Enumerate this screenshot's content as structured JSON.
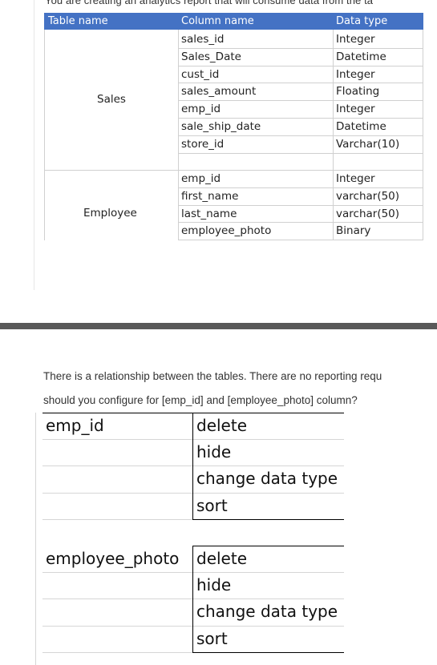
{
  "question_top": {
    "intro_text": "You are creating an analytics report that will consume data from the ta",
    "headers": [
      "Table name",
      "Column name",
      "Data type"
    ],
    "sales": {
      "table_name": "Sales",
      "columns": [
        "sales_id",
        "Sales_Date",
        "cust_id",
        "sales_amount",
        "emp_id",
        "sale_ship_date",
        "store_id"
      ],
      "types": [
        "Integer",
        "Datetime",
        "Integer",
        "Floating",
        "Integer",
        "Datetime",
        "Varchar(10)"
      ]
    },
    "employee": {
      "table_name": "Employee",
      "columns": [
        "emp_id",
        "first_name",
        "last_name",
        "employee_photo"
      ],
      "types": [
        "Integer",
        "varchar(50)",
        "varchar(50)",
        "Binary"
      ]
    }
  },
  "question_bottom": {
    "line1": "There is a relationship between the tables. There are no reporting requ",
    "line2": "should you configure for [emp_id] and [employee_photo] column?",
    "groups": [
      {
        "label": "emp_id",
        "options": [
          "delete",
          "hide",
          "change data type",
          "sort"
        ]
      },
      {
        "label": "employee_photo",
        "options": [
          "delete",
          "hide",
          "change data type",
          "sort"
        ]
      }
    ]
  },
  "colors": {
    "header_blue": "#4472c4",
    "divider": "#595959"
  }
}
